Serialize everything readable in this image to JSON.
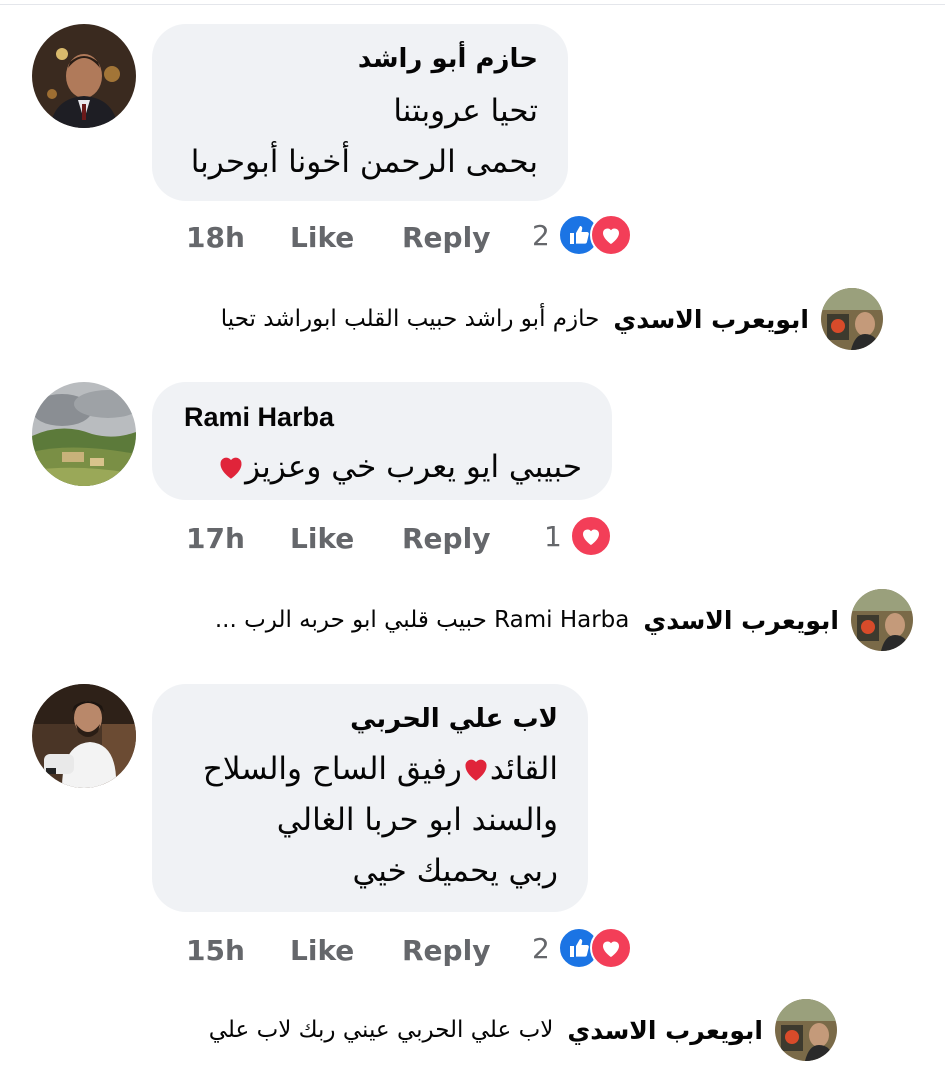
{
  "comments": [
    {
      "author": "حازم أبو راشد",
      "lines": [
        "تحيا عروبتنا",
        "بحمى الرحمن أخونا أبوحربا"
      ],
      "time": "18h",
      "like_label": "Like",
      "reply_label": "Reply",
      "reaction_count": "2",
      "reactions": [
        "like-icon",
        "love-icon"
      ],
      "reply_preview": {
        "author": "ابويعرب الاسدي",
        "text": "حازم أبو راشد حبيب القلب ابوراشد تحيا"
      }
    },
    {
      "author": "Rami Harba",
      "lines": [
        "حبيبي ايو يعرب خي وعزيز"
      ],
      "time": "17h",
      "like_label": "Like",
      "reply_label": "Reply",
      "reaction_count": "1",
      "reactions": [
        "love-icon"
      ],
      "reply_preview": {
        "author": "ابويعرب الاسدي",
        "text": "Rami Harba حبيب قلبي ابو حربه الرب ..."
      }
    },
    {
      "author": "لاب علي الحربي",
      "lines": [
        "القائد",
        "رفيق الساح والسلاح",
        "والسند ابو حربا الغالي",
        "ربي يحميك خيي"
      ],
      "time": "15h",
      "like_label": "Like",
      "reply_label": "Reply",
      "reaction_count": "2",
      "reactions": [
        "like-icon",
        "love-icon"
      ],
      "reply_preview": {
        "author": "ابويعرب الاسدي",
        "text": "لاب علي الحربي عيني ربك لاب علي"
      }
    }
  ],
  "colors": {
    "bubble": "#f0f2f5",
    "meta_text": "#65676b",
    "like_blue": "#1b74e4",
    "love_red": "#f33e58",
    "heart_emoji": "#e0243a"
  }
}
